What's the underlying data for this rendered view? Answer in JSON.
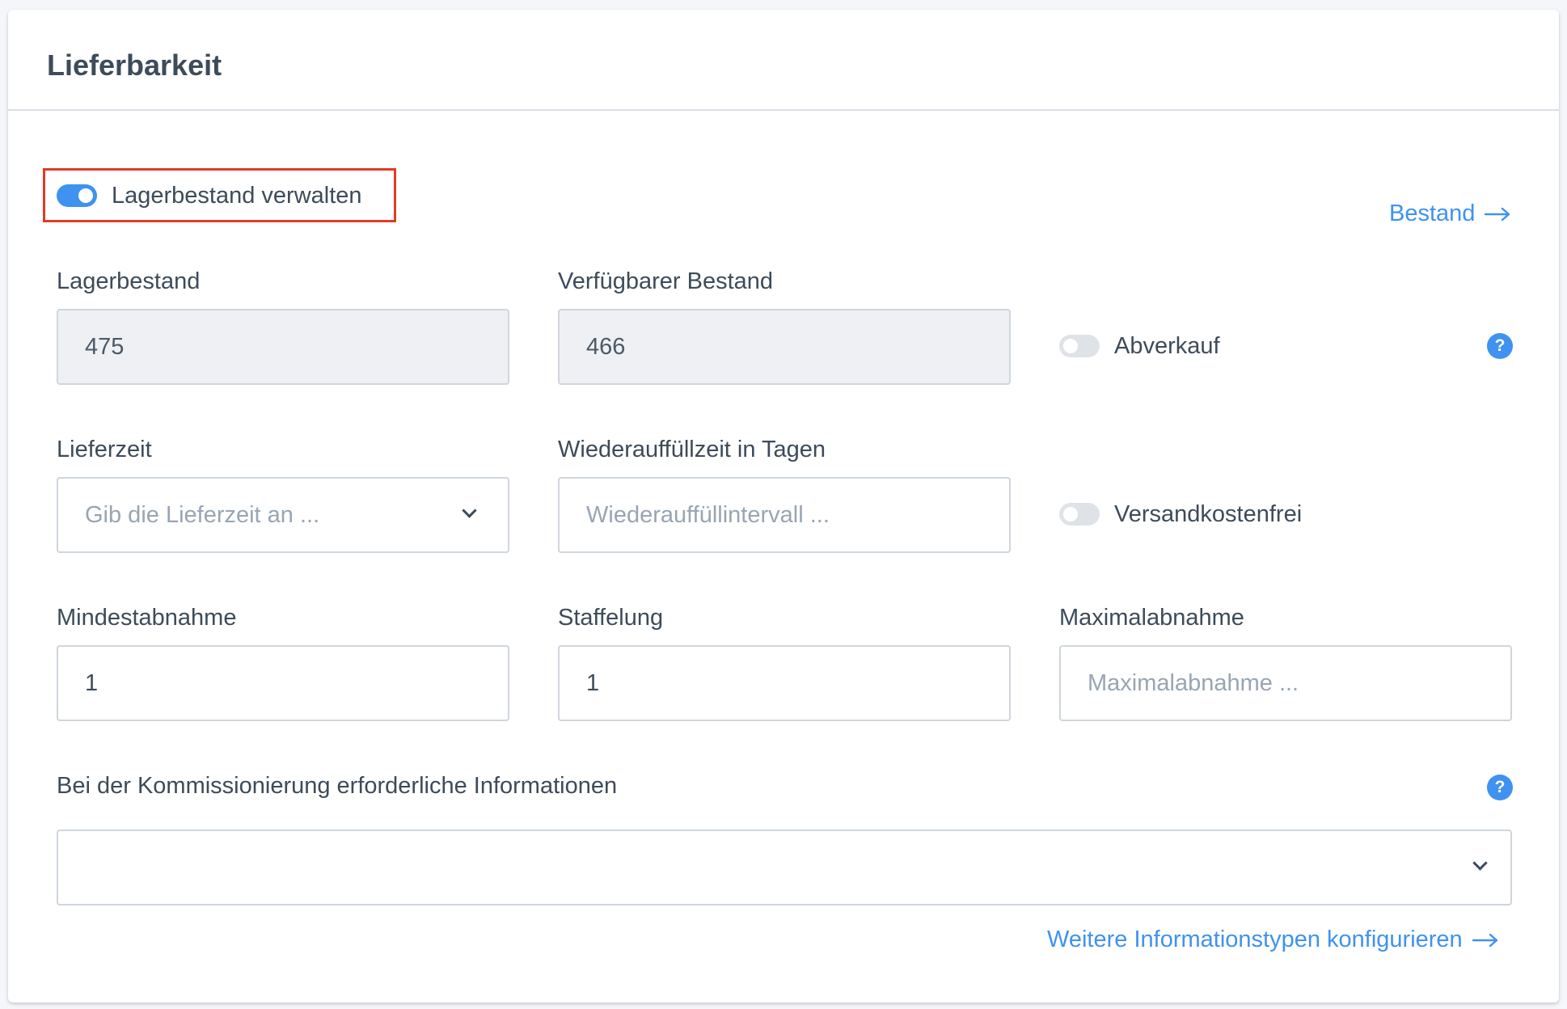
{
  "card": {
    "title": "Lieferbarkeit"
  },
  "manage_stock": {
    "label": "Lagerbestand verwalten",
    "enabled": true
  },
  "stock_link": {
    "label": "Bestand"
  },
  "stock": {
    "label": "Lagerbestand",
    "value": "475"
  },
  "available_stock": {
    "label": "Verfügbarer Bestand",
    "value": "466"
  },
  "clearance_sale": {
    "label": "Abverkauf",
    "enabled": false,
    "help_icon": "?"
  },
  "delivery_time": {
    "label": "Lieferzeit",
    "placeholder": "Gib die Lieferzeit an ..."
  },
  "restock_time": {
    "label": "Wiederauffüllzeit in Tagen",
    "placeholder": "Wiederauffüllintervall ..."
  },
  "free_shipping": {
    "label": "Versandkostenfrei",
    "enabled": false
  },
  "min_purchase": {
    "label": "Mindestabnahme",
    "value": "1"
  },
  "purchase_steps": {
    "label": "Staffelung",
    "value": "1"
  },
  "max_purchase": {
    "label": "Maximalabnahme",
    "placeholder": "Maximalabnahme ..."
  },
  "picking_info": {
    "label": "Bei der Kommissionierung erforderliche Informationen",
    "value": "",
    "help_icon": "?"
  },
  "configure_link": {
    "label": "Weitere Informationstypen konfigurieren"
  },
  "colors": {
    "accent": "#3f92f0",
    "highlight": "#e03c21",
    "toggle_off": "#dfe3e8"
  }
}
